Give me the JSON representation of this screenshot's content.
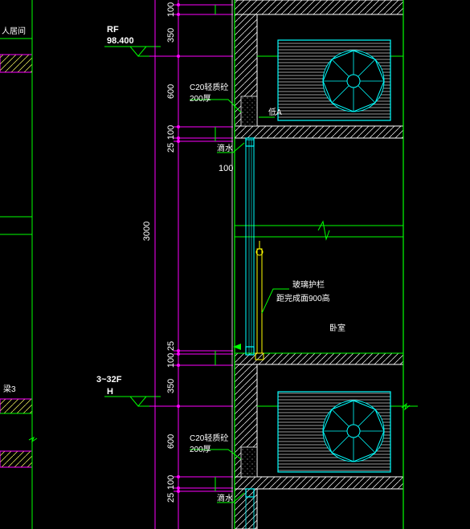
{
  "levels": {
    "rf": {
      "label": "RF",
      "elevation": "98.400"
    },
    "floor": {
      "label": "3~32F",
      "elevation": "H"
    }
  },
  "left_labels": {
    "top": "人居间",
    "bottom": "梁3"
  },
  "dimensions": {
    "upper": [
      "100",
      "350",
      "600",
      "100",
      "25"
    ],
    "middle": "3000",
    "lower": [
      "25",
      "100",
      "350",
      "600",
      "100",
      "25"
    ],
    "offset_upper": "100"
  },
  "notes": {
    "c20_upper": [
      "C20轻质砼",
      "200厚"
    ],
    "c20_lower": [
      "C20轻质砼",
      "200厚"
    ],
    "drain_upper": "滴水",
    "drain_lower": "滴水",
    "sill_tag": "低A",
    "guardrail": [
      "玻璃护栏",
      "距完成面900高"
    ],
    "room": "卧室"
  },
  "colors": {
    "background": "#000000",
    "green": "#00ff00",
    "magenta": "#ff00ff",
    "cyan": "#00ffff",
    "yellow": "#ffff00",
    "white": "#ffffff"
  }
}
